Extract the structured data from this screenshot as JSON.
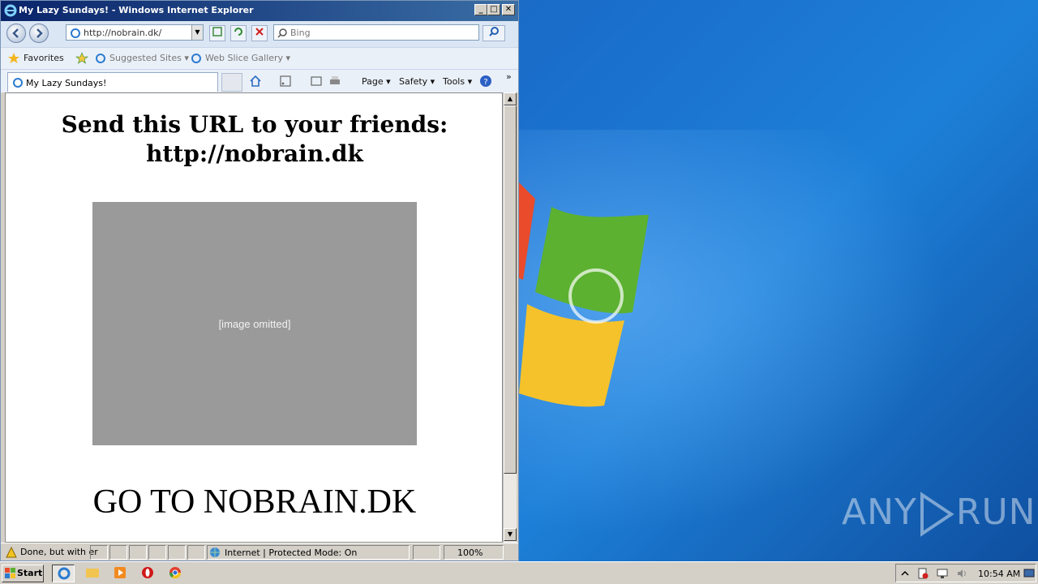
{
  "window": {
    "title": "My Lazy Sundays! - Windows Internet Explorer",
    "min": "_",
    "max": "□",
    "close": "✕"
  },
  "nav": {
    "address": "http://nobrain.dk/",
    "search_placeholder": "Bing",
    "dropdown": "▼"
  },
  "favorites": {
    "favorites_label": "Favorites",
    "suggested_label": "Suggested Sites ▾",
    "webslice_label": "Web Slice Gallery ▾"
  },
  "tabs": [
    {
      "label": "My Lazy Sundays!"
    }
  ],
  "commands": {
    "page": "Page ▾",
    "safety": "Safety ▾",
    "tools": "Tools ▾",
    "more": "»"
  },
  "page": {
    "heading_line1": "Send this URL to your friends:",
    "heading_line2": "http://nobrain.dk",
    "photo_placeholder": "[image omitted]",
    "goto_text": "GO TO NOBRAIN.DK"
  },
  "status": {
    "done_text": "Done, but with er",
    "zone_text": "Internet | Protected Mode: On",
    "zoom_text": "100%"
  },
  "taskbar": {
    "start_label": "Start",
    "clock": "10:54 AM"
  },
  "watermark": {
    "left": "ANY",
    "right": "RUN"
  }
}
